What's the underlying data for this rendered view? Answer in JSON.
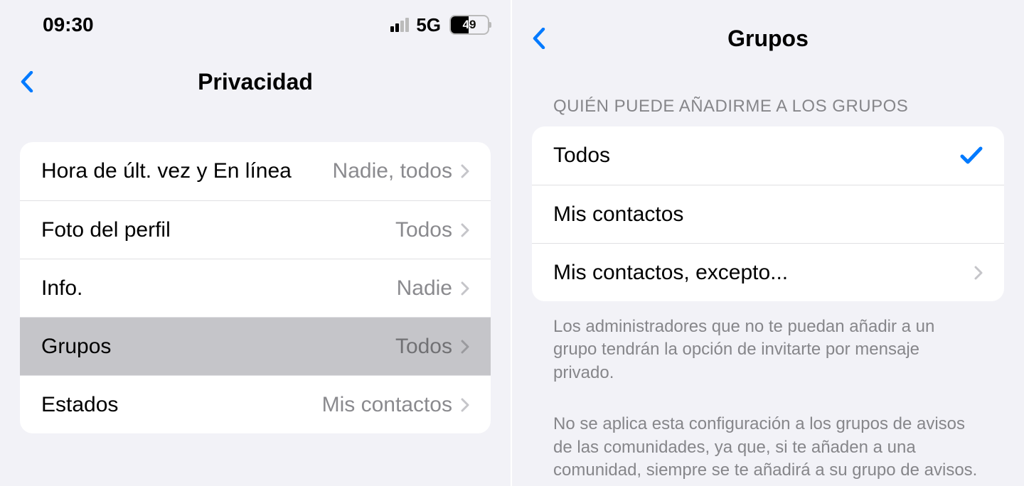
{
  "statusbar": {
    "time": "09:30",
    "network_label": "5G",
    "battery_pct": "49"
  },
  "left": {
    "title": "Privacidad",
    "rows": [
      {
        "label": "Hora de últ. vez y En línea",
        "value": "Nadie, todos"
      },
      {
        "label": "Foto del perfil",
        "value": "Todos"
      },
      {
        "label": "Info.",
        "value": "Nadie"
      },
      {
        "label": "Grupos",
        "value": "Todos"
      },
      {
        "label": "Estados",
        "value": "Mis contactos"
      }
    ]
  },
  "right": {
    "title": "Grupos",
    "section_header": "QUIÉN PUEDE AÑADIRME A LOS GRUPOS",
    "options": [
      {
        "label": "Todos"
      },
      {
        "label": "Mis contactos"
      },
      {
        "label": "Mis contactos, excepto..."
      }
    ],
    "footer1": "Los administradores que no te puedan añadir a un grupo tendrán la opción de invitarte por mensaje privado.",
    "footer2": "No se aplica esta configuración a los grupos de avisos de las comunidades, ya que, si te añaden a una comunidad, siempre se te añadirá a su grupo de avisos."
  }
}
